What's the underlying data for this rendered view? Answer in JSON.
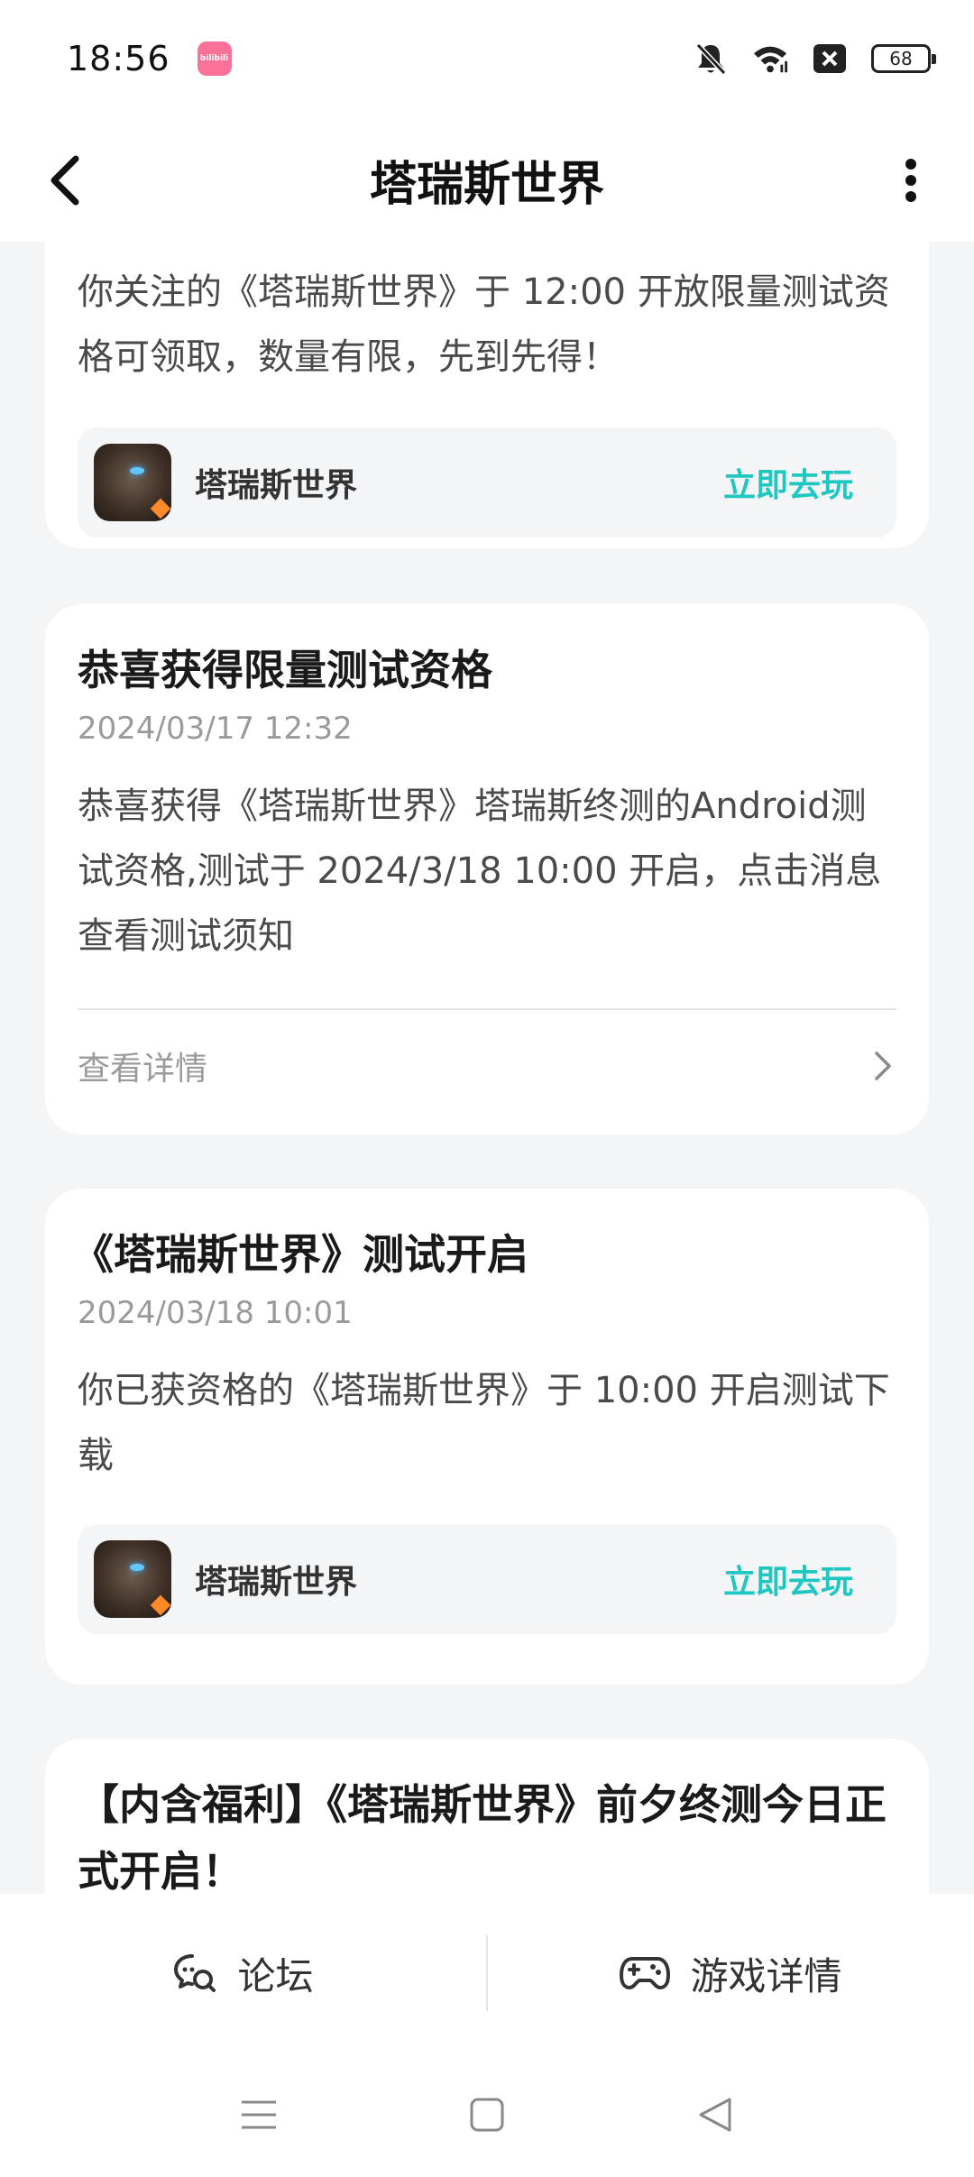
{
  "status_bar": {
    "time": "18:56",
    "app_badge": "bilibili",
    "battery": "68",
    "icons": [
      "bell-off-icon",
      "wifi-icon",
      "close-box-icon",
      "battery-icon"
    ]
  },
  "header": {
    "title": "塔瑞斯世界",
    "back_icon": "chevron-left-icon",
    "more_icon": "more-vertical-icon"
  },
  "messages": [
    {
      "body": "你关注的《塔瑞斯世界》于 12:00 开放限量测试资格可领取，数量有限，先到先得！",
      "game": {
        "name": "塔瑞斯世界",
        "action": "立即去玩"
      }
    },
    {
      "title": "恭喜获得限量测试资格",
      "date": "2024/03/17 12:32",
      "body": "恭喜获得《塔瑞斯世界》塔瑞斯终测的Android测试资格,测试于 2024/3/18 10:00 开启，点击消息查看测试须知",
      "detail_label": "查看详情"
    },
    {
      "title": "《塔瑞斯世界》测试开启",
      "date": "2024/03/18 10:01",
      "body": "你已获资格的《塔瑞斯世界》于 10:00 开启测试下载",
      "game": {
        "name": "塔瑞斯世界",
        "action": "立即去玩"
      }
    },
    {
      "title": "【内含福利】《塔瑞斯世界》前夕终测今日正式开启！"
    }
  ],
  "tabbar": {
    "forum": "论坛",
    "game_detail": "游戏详情"
  },
  "colors": {
    "accent": "#1fc7c0",
    "background": "#f4f5f7",
    "card": "#ffffff"
  }
}
